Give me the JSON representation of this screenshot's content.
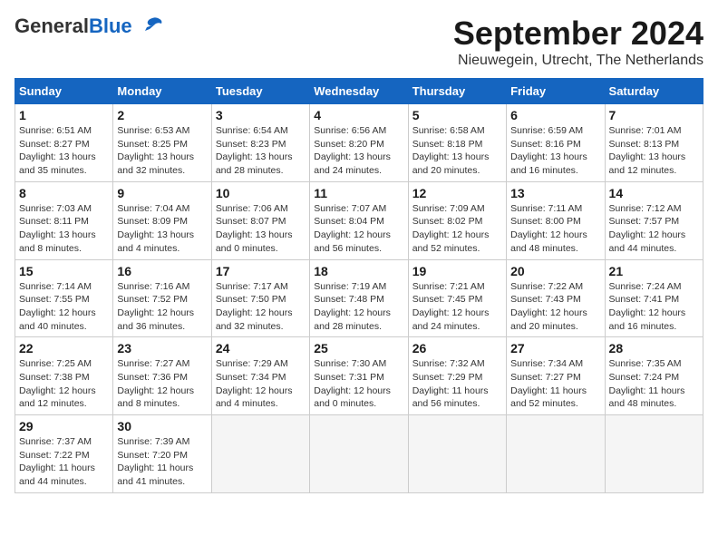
{
  "header": {
    "logo_general": "General",
    "logo_blue": "Blue",
    "month": "September 2024",
    "location": "Nieuwegein, Utrecht, The Netherlands"
  },
  "weekdays": [
    "Sunday",
    "Monday",
    "Tuesday",
    "Wednesday",
    "Thursday",
    "Friday",
    "Saturday"
  ],
  "weeks": [
    [
      {
        "day": "1",
        "sunrise": "Sunrise: 6:51 AM",
        "sunset": "Sunset: 8:27 PM",
        "daylight": "Daylight: 13 hours and 35 minutes."
      },
      {
        "day": "2",
        "sunrise": "Sunrise: 6:53 AM",
        "sunset": "Sunset: 8:25 PM",
        "daylight": "Daylight: 13 hours and 32 minutes."
      },
      {
        "day": "3",
        "sunrise": "Sunrise: 6:54 AM",
        "sunset": "Sunset: 8:23 PM",
        "daylight": "Daylight: 13 hours and 28 minutes."
      },
      {
        "day": "4",
        "sunrise": "Sunrise: 6:56 AM",
        "sunset": "Sunset: 8:20 PM",
        "daylight": "Daylight: 13 hours and 24 minutes."
      },
      {
        "day": "5",
        "sunrise": "Sunrise: 6:58 AM",
        "sunset": "Sunset: 8:18 PM",
        "daylight": "Daylight: 13 hours and 20 minutes."
      },
      {
        "day": "6",
        "sunrise": "Sunrise: 6:59 AM",
        "sunset": "Sunset: 8:16 PM",
        "daylight": "Daylight: 13 hours and 16 minutes."
      },
      {
        "day": "7",
        "sunrise": "Sunrise: 7:01 AM",
        "sunset": "Sunset: 8:13 PM",
        "daylight": "Daylight: 13 hours and 12 minutes."
      }
    ],
    [
      {
        "day": "8",
        "sunrise": "Sunrise: 7:03 AM",
        "sunset": "Sunset: 8:11 PM",
        "daylight": "Daylight: 13 hours and 8 minutes."
      },
      {
        "day": "9",
        "sunrise": "Sunrise: 7:04 AM",
        "sunset": "Sunset: 8:09 PM",
        "daylight": "Daylight: 13 hours and 4 minutes."
      },
      {
        "day": "10",
        "sunrise": "Sunrise: 7:06 AM",
        "sunset": "Sunset: 8:07 PM",
        "daylight": "Daylight: 13 hours and 0 minutes."
      },
      {
        "day": "11",
        "sunrise": "Sunrise: 7:07 AM",
        "sunset": "Sunset: 8:04 PM",
        "daylight": "Daylight: 12 hours and 56 minutes."
      },
      {
        "day": "12",
        "sunrise": "Sunrise: 7:09 AM",
        "sunset": "Sunset: 8:02 PM",
        "daylight": "Daylight: 12 hours and 52 minutes."
      },
      {
        "day": "13",
        "sunrise": "Sunrise: 7:11 AM",
        "sunset": "Sunset: 8:00 PM",
        "daylight": "Daylight: 12 hours and 48 minutes."
      },
      {
        "day": "14",
        "sunrise": "Sunrise: 7:12 AM",
        "sunset": "Sunset: 7:57 PM",
        "daylight": "Daylight: 12 hours and 44 minutes."
      }
    ],
    [
      {
        "day": "15",
        "sunrise": "Sunrise: 7:14 AM",
        "sunset": "Sunset: 7:55 PM",
        "daylight": "Daylight: 12 hours and 40 minutes."
      },
      {
        "day": "16",
        "sunrise": "Sunrise: 7:16 AM",
        "sunset": "Sunset: 7:52 PM",
        "daylight": "Daylight: 12 hours and 36 minutes."
      },
      {
        "day": "17",
        "sunrise": "Sunrise: 7:17 AM",
        "sunset": "Sunset: 7:50 PM",
        "daylight": "Daylight: 12 hours and 32 minutes."
      },
      {
        "day": "18",
        "sunrise": "Sunrise: 7:19 AM",
        "sunset": "Sunset: 7:48 PM",
        "daylight": "Daylight: 12 hours and 28 minutes."
      },
      {
        "day": "19",
        "sunrise": "Sunrise: 7:21 AM",
        "sunset": "Sunset: 7:45 PM",
        "daylight": "Daylight: 12 hours and 24 minutes."
      },
      {
        "day": "20",
        "sunrise": "Sunrise: 7:22 AM",
        "sunset": "Sunset: 7:43 PM",
        "daylight": "Daylight: 12 hours and 20 minutes."
      },
      {
        "day": "21",
        "sunrise": "Sunrise: 7:24 AM",
        "sunset": "Sunset: 7:41 PM",
        "daylight": "Daylight: 12 hours and 16 minutes."
      }
    ],
    [
      {
        "day": "22",
        "sunrise": "Sunrise: 7:25 AM",
        "sunset": "Sunset: 7:38 PM",
        "daylight": "Daylight: 12 hours and 12 minutes."
      },
      {
        "day": "23",
        "sunrise": "Sunrise: 7:27 AM",
        "sunset": "Sunset: 7:36 PM",
        "daylight": "Daylight: 12 hours and 8 minutes."
      },
      {
        "day": "24",
        "sunrise": "Sunrise: 7:29 AM",
        "sunset": "Sunset: 7:34 PM",
        "daylight": "Daylight: 12 hours and 4 minutes."
      },
      {
        "day": "25",
        "sunrise": "Sunrise: 7:30 AM",
        "sunset": "Sunset: 7:31 PM",
        "daylight": "Daylight: 12 hours and 0 minutes."
      },
      {
        "day": "26",
        "sunrise": "Sunrise: 7:32 AM",
        "sunset": "Sunset: 7:29 PM",
        "daylight": "Daylight: 11 hours and 56 minutes."
      },
      {
        "day": "27",
        "sunrise": "Sunrise: 7:34 AM",
        "sunset": "Sunset: 7:27 PM",
        "daylight": "Daylight: 11 hours and 52 minutes."
      },
      {
        "day": "28",
        "sunrise": "Sunrise: 7:35 AM",
        "sunset": "Sunset: 7:24 PM",
        "daylight": "Daylight: 11 hours and 48 minutes."
      }
    ],
    [
      {
        "day": "29",
        "sunrise": "Sunrise: 7:37 AM",
        "sunset": "Sunset: 7:22 PM",
        "daylight": "Daylight: 11 hours and 44 minutes."
      },
      {
        "day": "30",
        "sunrise": "Sunrise: 7:39 AM",
        "sunset": "Sunset: 7:20 PM",
        "daylight": "Daylight: 11 hours and 41 minutes."
      },
      null,
      null,
      null,
      null,
      null
    ]
  ]
}
